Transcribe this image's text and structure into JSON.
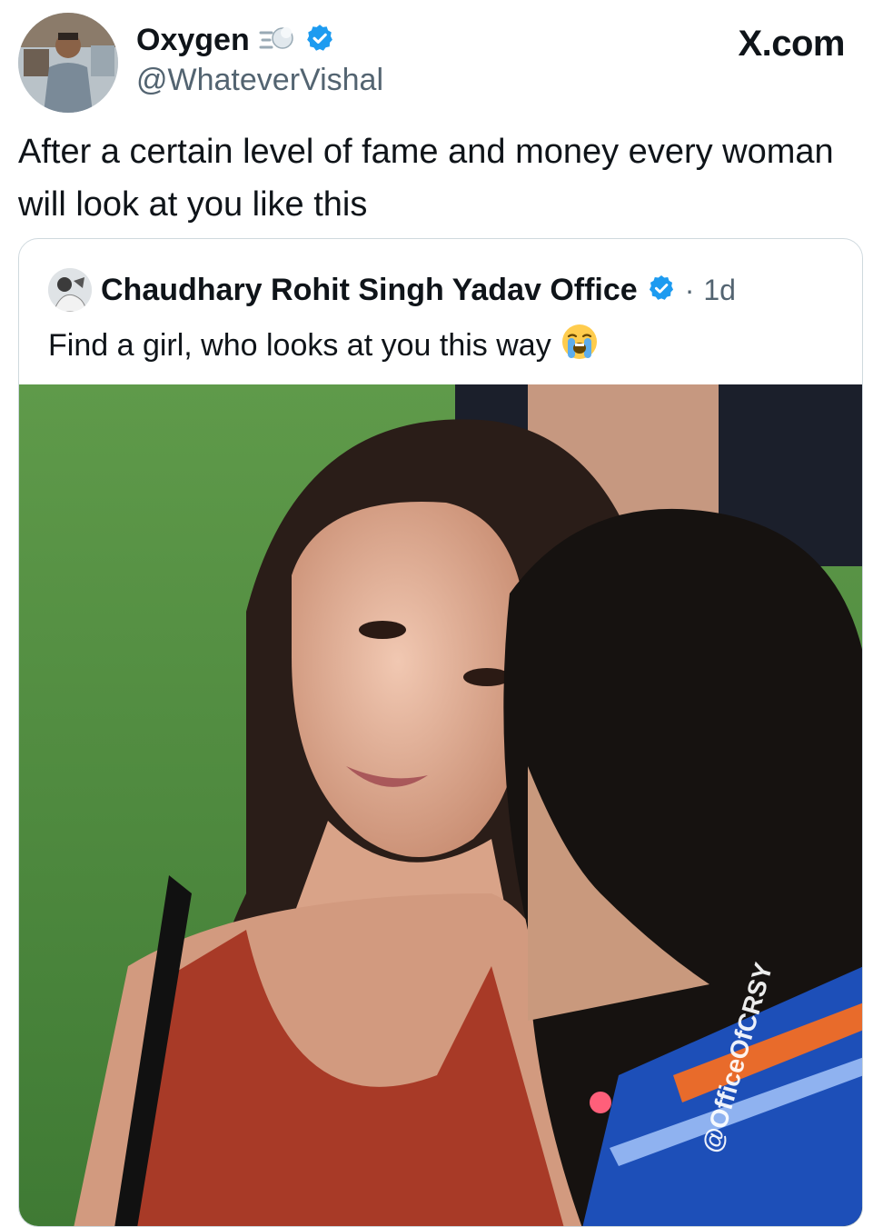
{
  "post": {
    "display_name": "Oxygen",
    "handle": "@WhateverVishal",
    "name_emoji": "dash-symbol",
    "verified_icon": "verified-badge-icon",
    "avatar": "profile-photo",
    "text": "After a certain level of fame and money every woman will look at you like this"
  },
  "brand": {
    "label": "X.com"
  },
  "quote": {
    "display_name": "Chaudhary Rohit Singh Yadav Office",
    "separator": "·",
    "time": "1d",
    "verified_icon": "verified-badge-icon",
    "avatar": "profile-photo",
    "text": "Find a girl, who looks at you this way",
    "emoji": "loudly-crying-face",
    "media": {
      "type": "photo",
      "watermark": "@OfficeOfCRSY"
    }
  },
  "colors": {
    "text_primary": "#0f1419",
    "text_secondary": "#536471",
    "verified": "#1d9bf0",
    "border": "#cfd9de"
  }
}
